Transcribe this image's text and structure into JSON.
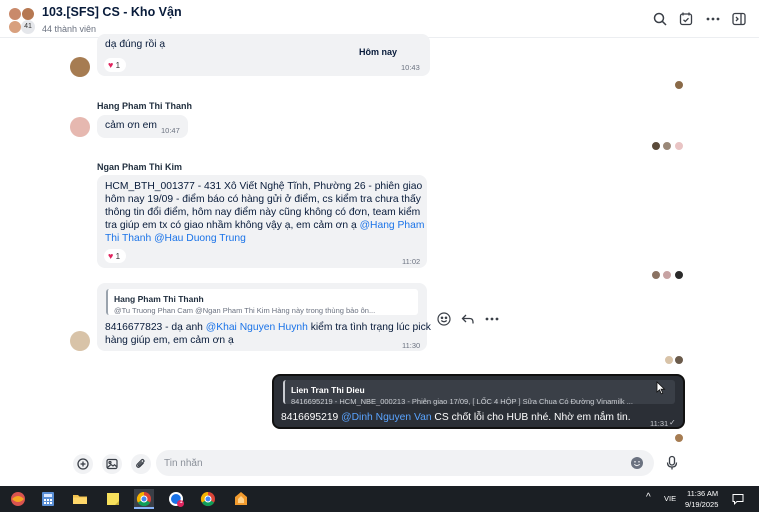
{
  "header": {
    "title": "103.[SFS] CS - Kho Vận",
    "subtitle": "44 thành viên",
    "member_badge": "41",
    "icons": [
      "search-icon",
      "task-icon",
      "more-icon",
      "sidebar-toggle-icon"
    ]
  },
  "messages": {
    "m1": {
      "text": "dạ đúng rồi ạ",
      "day_label": "Hôm nay",
      "time": "10:43",
      "reaction_count": "1"
    },
    "m2": {
      "sender": "Hang Pham Thi Thanh",
      "text": "cảm ơn em",
      "time": "10:47"
    },
    "m3": {
      "sender": "Ngan Pham Thi Kim",
      "line1": "HCM_BTH_001377 - 431 Xô Viết Nghệ Tĩnh, Phường 26 - phiên giao",
      "line2": "hôm nay 19/09 - điểm báo có hàng gửi ở điểm, cs kiểm tra chưa thấy",
      "line3": "thông tin đổi điểm, hôm nay điểm này cũng không có đơn, team kiểm",
      "line4_pre": "tra giúp em tx có giao nhầm không vậy ạ, em cảm ơn ạ ",
      "mention1a": "@Hang Pham",
      "mention1b": "Thi Thanh",
      "mention2": "@Hau Duong Trung",
      "time": "11:02",
      "reaction_count": "1"
    },
    "m4": {
      "quote_name": "Hang Pham Thi Thanh",
      "quote_text": "@Tu Truong Phan Cam @Ngan Pham Thi Kim Hàng này trong thùng bảo ôn...",
      "text_pre": "8416677823  - dạ anh ",
      "mention": "@Khai Nguyen Huynh",
      "text_post": " kiểm tra tình trạng lúc pick",
      "line2": "hàng giúp em, em cảm ơn ạ",
      "time": "11:30"
    },
    "m5": {
      "quote_name": "Lien Tran Thi Dieu",
      "quote_text": "8416695219 - HCM_NBE_000213 - Phiên giao 17/09, [ LỐC 4 HỘP ] Sữa Chua Có Đường Vinamilk ...",
      "text_pre": "8416695219 ",
      "mention": "@Dinh Nguyen Van",
      "text_post": "  CS chốt lỗi cho HUB nhé. Nhờ em nắm tin.",
      "time": "11:31"
    }
  },
  "composer": {
    "placeholder": "Tin nhắn",
    "icons": [
      "add-icon",
      "image-icon",
      "attach-icon",
      "emoji-icon",
      "mic-icon"
    ]
  },
  "taskbar": {
    "language": "VIE",
    "time": "11:36 AM",
    "date": "9/19/2025",
    "notification_badge": "1"
  }
}
